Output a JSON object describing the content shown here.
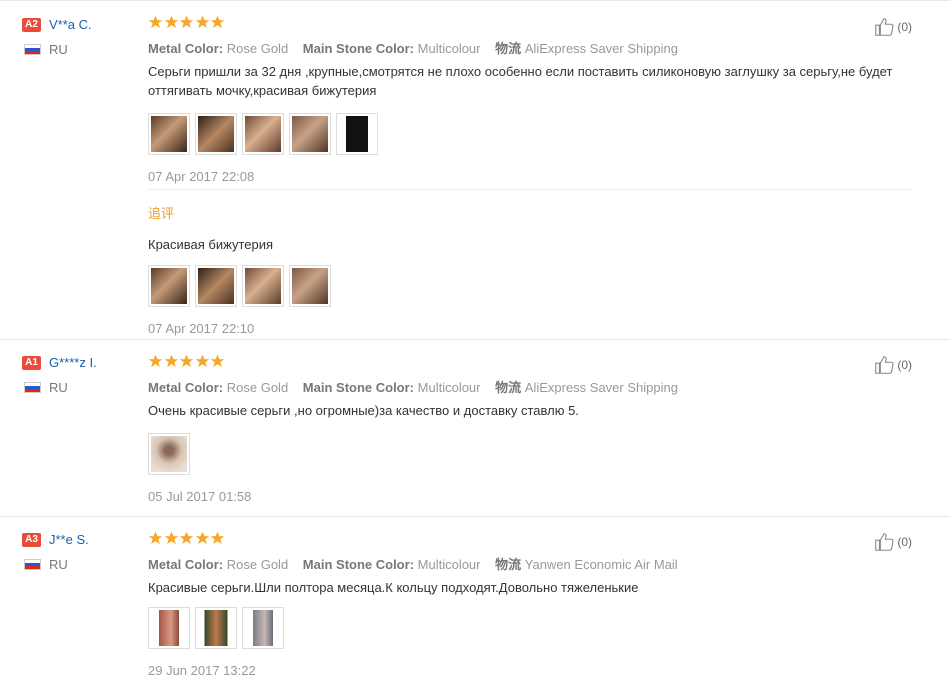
{
  "reviews": [
    {
      "badge": "A2",
      "badge_color": "#e74c3c",
      "name": "V**a C.",
      "country": "RU",
      "rating": 5,
      "attrs": [
        {
          "key": "Metal Color:",
          "value": "Rose Gold"
        },
        {
          "key": "Main Stone Color:",
          "value": "Multicolour"
        },
        {
          "key": "物流",
          "value": "AliExpress Saver Shipping"
        }
      ],
      "text": "Серьги пришли за 32 дня ,крупные,смотрятся не плохо особенно если поставить силиконовую заглушку за серьгу,не будет оттягивать мочку,красивая бижутерия",
      "date": "07 Apr 2017 22:08",
      "likes": "(0)",
      "followup": {
        "label": "追评",
        "text": "Красивая бижутерия",
        "date": "07 Apr 2017 22:10"
      }
    },
    {
      "badge": "A1",
      "badge_color": "#e74c3c",
      "name": "G****z I.",
      "country": "RU",
      "rating": 5,
      "attrs": [
        {
          "key": "Metal Color:",
          "value": "Rose Gold"
        },
        {
          "key": "Main Stone Color:",
          "value": "Multicolour"
        },
        {
          "key": "物流",
          "value": "AliExpress Saver Shipping"
        }
      ],
      "text": "Очень красивые серьги ,но огромные)за качество и доставку ставлю 5.",
      "date": "05 Jul 2017 01:58",
      "likes": "(0)"
    },
    {
      "badge": "A3",
      "badge_color": "#e74c3c",
      "name": "J**e S.",
      "country": "RU",
      "rating": 5,
      "attrs": [
        {
          "key": "Metal Color:",
          "value": "Rose Gold"
        },
        {
          "key": "Main Stone Color:",
          "value": "Multicolour"
        },
        {
          "key": "物流",
          "value": "Yanwen Economic Air Mail"
        }
      ],
      "text": "Красивые серьги.Шли полтора месяца.К кольцу подходят.Довольно тяжеленькие",
      "date": "29 Jun 2017 13:22",
      "likes": "(0)"
    }
  ]
}
